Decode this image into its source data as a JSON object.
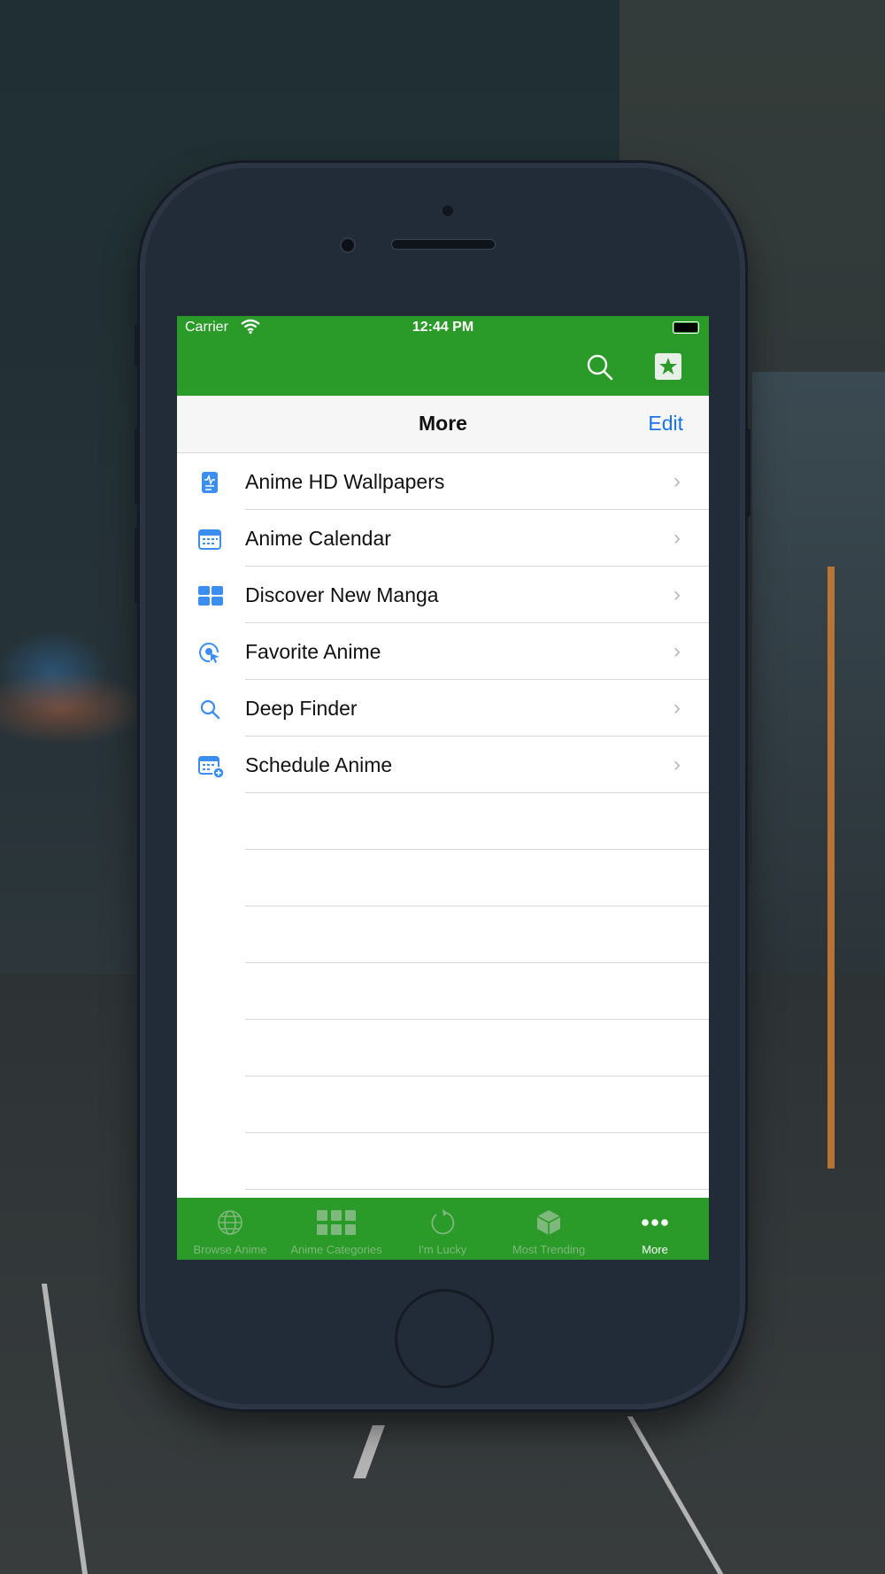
{
  "status_bar": {
    "carrier": "Carrier",
    "time": "12:44 PM"
  },
  "toolbar": {
    "search_icon": "search-icon",
    "favorites_icon": "star-square-icon"
  },
  "nav": {
    "title": "More",
    "edit_label": "Edit"
  },
  "menu": {
    "items": [
      {
        "label": "Anime HD Wallpapers",
        "icon": "wallpaper-doc-icon"
      },
      {
        "label": "Anime Calendar",
        "icon": "calendar-icon"
      },
      {
        "label": "Discover New Manga",
        "icon": "grid-tiles-icon"
      },
      {
        "label": "Favorite Anime",
        "icon": "target-cursor-icon"
      },
      {
        "label": "Deep Finder",
        "icon": "magnifier-icon"
      },
      {
        "label": "Schedule Anime",
        "icon": "calendar-add-icon"
      }
    ]
  },
  "tab_bar": {
    "tabs": [
      {
        "label": "Browse Anime",
        "icon": "globe-icon",
        "active": false
      },
      {
        "label": "Anime Categories",
        "icon": "grid-icon",
        "active": false
      },
      {
        "label": "I'm Lucky",
        "icon": "refresh-icon",
        "active": false
      },
      {
        "label": "Most Trending",
        "icon": "cube-icon",
        "active": false
      },
      {
        "label": "More",
        "icon": "ellipsis-icon",
        "active": true
      }
    ]
  },
  "colors": {
    "green": "#2a9a28",
    "accent_blue": "#1a73e8",
    "icon_blue": "#3b8ef0"
  }
}
